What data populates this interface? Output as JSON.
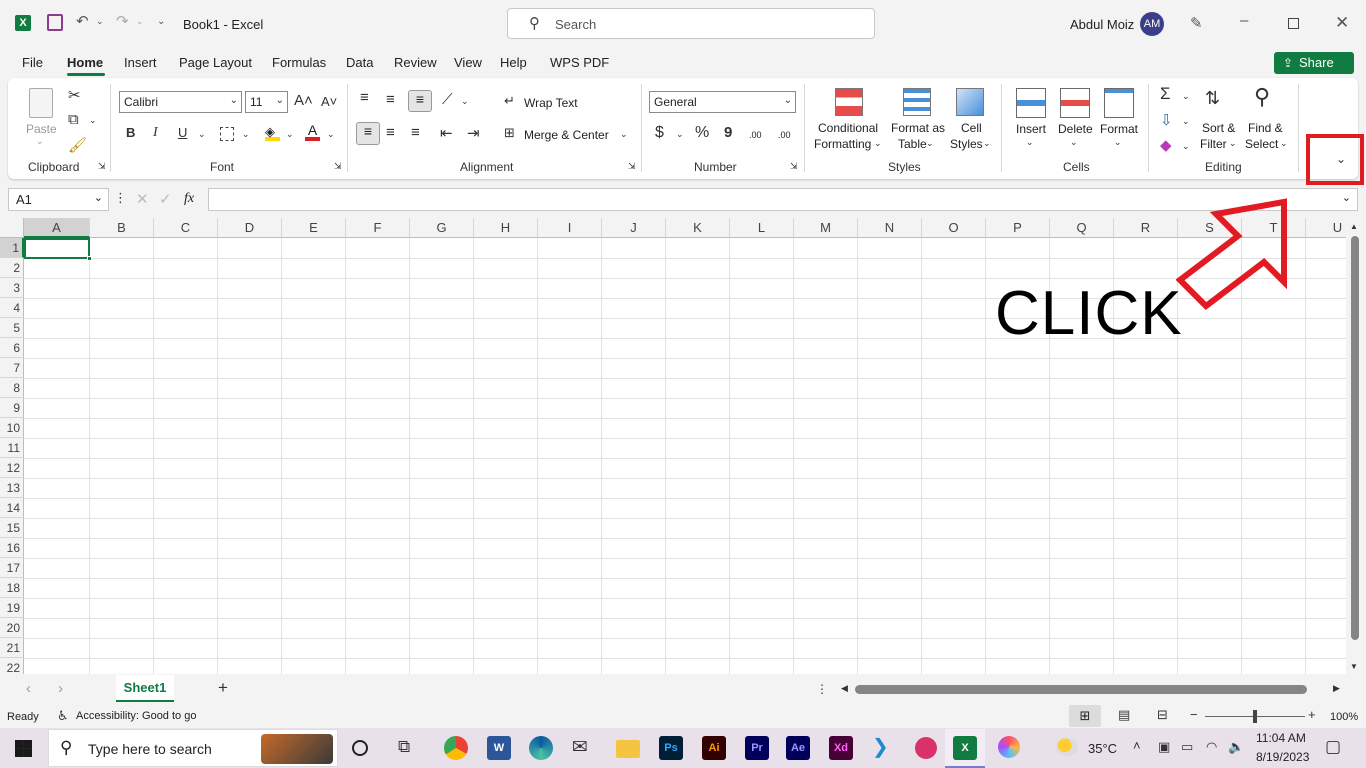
{
  "titlebar": {
    "doc_title": "Book1  -  Excel",
    "search_placeholder": "Search",
    "user_name": "Abdul Moiz",
    "user_initials": "AM"
  },
  "menu": {
    "tabs": [
      "File",
      "Home",
      "Insert",
      "Page Layout",
      "Formulas",
      "Data",
      "Review",
      "View",
      "Help",
      "WPS PDF"
    ],
    "active": "Home",
    "share_label": "Share"
  },
  "ribbon": {
    "clipboard": {
      "label": "Clipboard",
      "paste": "Paste"
    },
    "font": {
      "label": "Font",
      "font_name": "Calibri",
      "font_size": "11",
      "bold": "B",
      "italic": "I",
      "underline": "U"
    },
    "alignment": {
      "label": "Alignment",
      "wrap_text": "Wrap Text",
      "merge_center": "Merge & Center"
    },
    "number": {
      "label": "Number",
      "format": "General",
      "currency": "$",
      "percent": "%",
      "comma": "9",
      "inc_decimal": ".00",
      "dec_decimal": ".00"
    },
    "styles": {
      "label": "Styles",
      "conditional_1": "Conditional",
      "conditional_2": "Formatting",
      "format_table_1": "Format as",
      "format_table_2": "Table",
      "cell_styles_1": "Cell",
      "cell_styles_2": "Styles"
    },
    "cells": {
      "label": "Cells",
      "insert": "Insert",
      "delete": "Delete",
      "format": "Format"
    },
    "editing": {
      "label": "Editing",
      "sort_1": "Sort &",
      "sort_2": "Filter",
      "find_1": "Find &",
      "find_2": "Select"
    }
  },
  "formula_bar": {
    "name_box": "A1",
    "fx": "fx",
    "value": ""
  },
  "grid": {
    "columns": [
      "A",
      "B",
      "C",
      "D",
      "E",
      "F",
      "G",
      "H",
      "I",
      "J",
      "K",
      "L",
      "M",
      "N",
      "O",
      "P",
      "Q",
      "R",
      "S",
      "T",
      "U"
    ],
    "rows": [
      "1",
      "2",
      "3",
      "4",
      "5",
      "6",
      "7",
      "8",
      "9",
      "10",
      "11",
      "12",
      "13",
      "14",
      "15",
      "16",
      "17",
      "18",
      "19",
      "20",
      "21",
      "22"
    ],
    "selected_cell": "A1"
  },
  "sheets": {
    "tabs": [
      "Sheet1"
    ],
    "active": "Sheet1"
  },
  "status": {
    "ready": "Ready",
    "accessibility": "Accessibility: Good to go",
    "zoom": "100%"
  },
  "taskbar": {
    "search_placeholder": "Type here to search",
    "temperature": "35°C",
    "time": "11:04 AM",
    "date": "8/19/2023",
    "apps": [
      {
        "name": "Ps",
        "color": "#001e36",
        "fg": "#31a8ff"
      },
      {
        "name": "Ai",
        "color": "#330000",
        "fg": "#ff9a00"
      },
      {
        "name": "Pr",
        "color": "#00005b",
        "fg": "#9999ff"
      },
      {
        "name": "Ae",
        "color": "#00005b",
        "fg": "#9999ff"
      },
      {
        "name": "Xd",
        "color": "#470137",
        "fg": "#ff61f6"
      }
    ]
  },
  "annotation": {
    "text": "CLICK",
    "color": "#e21b23"
  },
  "colors": {
    "excel_green": "#107c41",
    "annotation_red": "#e21b23"
  }
}
